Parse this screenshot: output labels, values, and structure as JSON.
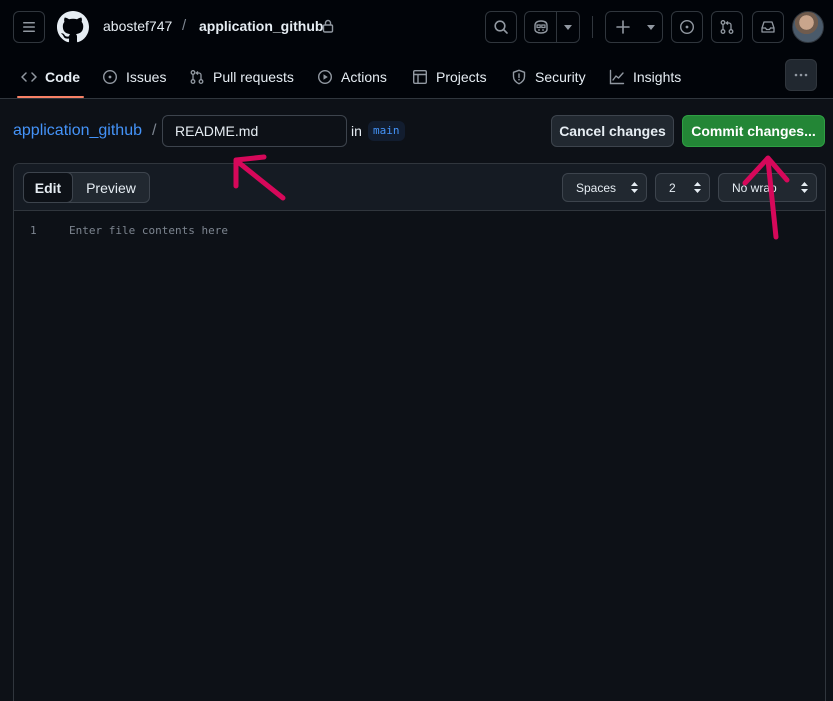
{
  "header": {
    "owner": "abostef747",
    "separator": "/",
    "repo": "application_github"
  },
  "nav": {
    "tabs": [
      {
        "label": "Code",
        "icon": "code-icon",
        "active": true
      },
      {
        "label": "Issues",
        "icon": "issue-opened-icon"
      },
      {
        "label": "Pull requests",
        "icon": "git-pull-request-icon"
      },
      {
        "label": "Actions",
        "icon": "play-icon"
      },
      {
        "label": "Projects",
        "icon": "table-icon"
      },
      {
        "label": "Security",
        "icon": "shield-icon"
      },
      {
        "label": "Insights",
        "icon": "graph-icon"
      }
    ]
  },
  "editor_header": {
    "repo_link": "application_github",
    "separator": "/",
    "filename": "README.md",
    "in_label": "in",
    "branch": "main",
    "cancel_label": "Cancel changes",
    "commit_label": "Commit changes..."
  },
  "editor": {
    "edit_tab": "Edit",
    "preview_tab": "Preview",
    "indent_mode": "Spaces",
    "indent_size": "2",
    "wrap_mode": "No wrap",
    "line_number": "1",
    "placeholder": "Enter file contents here"
  },
  "annotations": {
    "arrow_color": "#d6085a"
  }
}
